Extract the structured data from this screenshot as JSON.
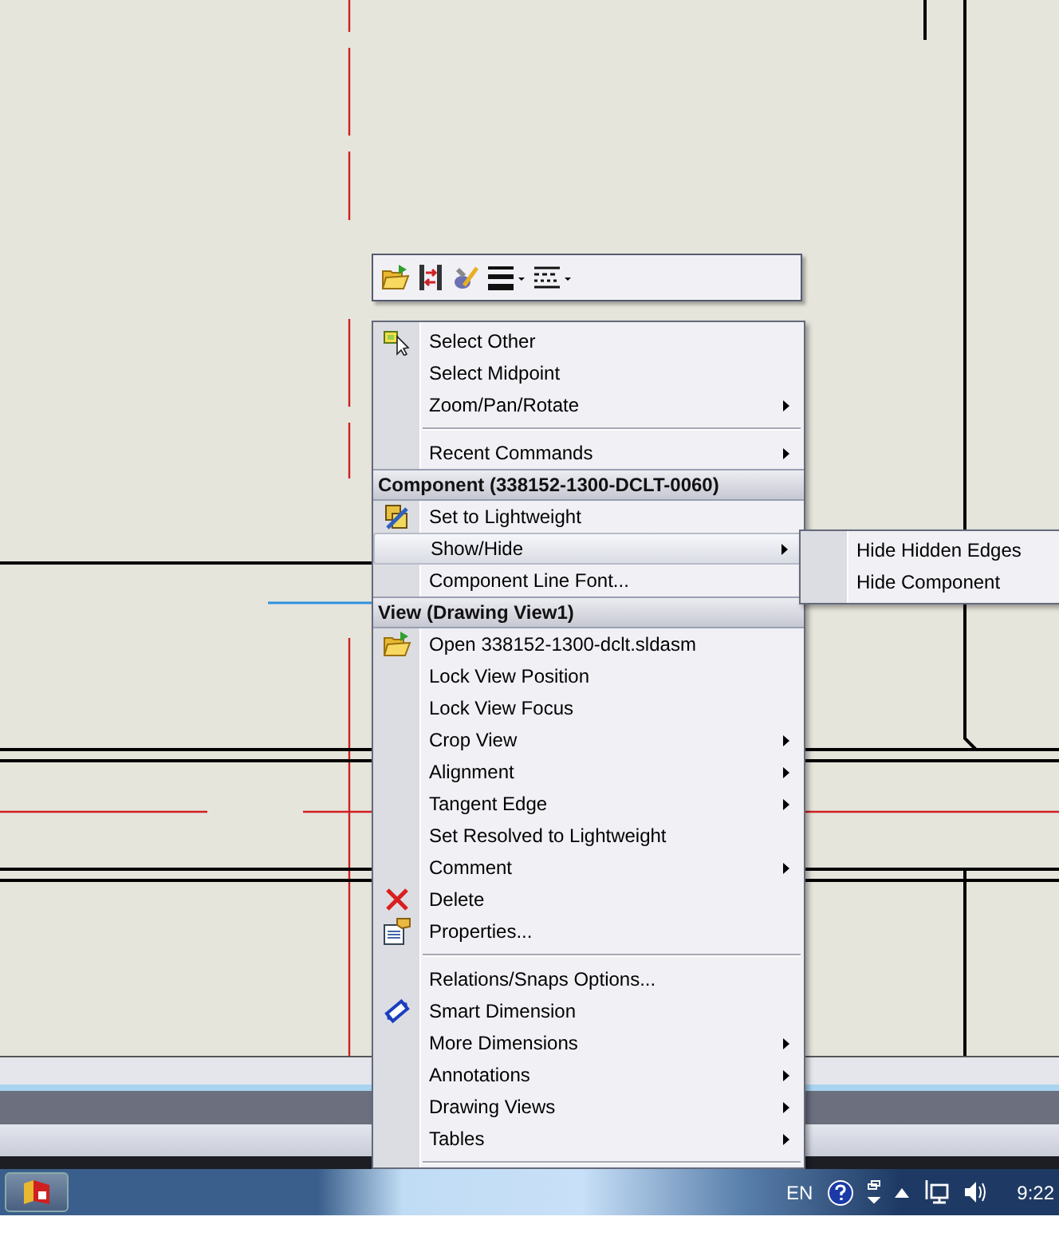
{
  "context_menu": {
    "items": [
      {
        "kind": "item",
        "label": "Select Other",
        "submenu": false,
        "selected": false
      },
      {
        "kind": "item",
        "label": "Select Midpoint",
        "submenu": false,
        "selected": false
      },
      {
        "kind": "item",
        "label": "Zoom/Pan/Rotate",
        "submenu": true,
        "selected": false
      },
      {
        "kind": "separator"
      },
      {
        "kind": "item",
        "label": "Recent Commands",
        "submenu": true,
        "selected": false
      },
      {
        "kind": "header",
        "label": "Component (338152-1300-DCLT-0060)"
      },
      {
        "kind": "item",
        "label": "Set to Lightweight",
        "submenu": false,
        "selected": false
      },
      {
        "kind": "item",
        "label": "Show/Hide",
        "submenu": true,
        "selected": true
      },
      {
        "kind": "item",
        "label": "Component Line Font...",
        "submenu": false,
        "selected": false
      },
      {
        "kind": "header",
        "label": "View (Drawing View1)"
      },
      {
        "kind": "item",
        "label": "Open 338152-1300-dclt.sldasm",
        "submenu": false,
        "selected": false
      },
      {
        "kind": "item",
        "label": "Lock View Position",
        "submenu": false,
        "selected": false
      },
      {
        "kind": "item",
        "label": "Lock View Focus",
        "submenu": false,
        "selected": false
      },
      {
        "kind": "item",
        "label": "Crop View",
        "submenu": true,
        "selected": false
      },
      {
        "kind": "item",
        "label": "Alignment",
        "submenu": true,
        "selected": false
      },
      {
        "kind": "item",
        "label": "Tangent Edge",
        "submenu": true,
        "selected": false
      },
      {
        "kind": "item",
        "label": "Set Resolved to Lightweight",
        "submenu": false,
        "selected": false
      },
      {
        "kind": "item",
        "label": "Comment",
        "submenu": true,
        "selected": false
      },
      {
        "kind": "item",
        "label": "Delete",
        "submenu": false,
        "selected": false
      },
      {
        "kind": "item",
        "label": "Properties...",
        "submenu": false,
        "selected": false
      },
      {
        "kind": "separator"
      },
      {
        "kind": "item",
        "label": "Relations/Snaps Options...",
        "submenu": false,
        "selected": false
      },
      {
        "kind": "item",
        "label": "Smart Dimension",
        "submenu": false,
        "selected": false
      },
      {
        "kind": "item",
        "label": "More Dimensions",
        "submenu": true,
        "selected": false
      },
      {
        "kind": "item",
        "label": "Annotations",
        "submenu": true,
        "selected": false
      },
      {
        "kind": "item",
        "label": "Drawing Views",
        "submenu": true,
        "selected": false
      },
      {
        "kind": "item",
        "label": "Tables",
        "submenu": true,
        "selected": false
      },
      {
        "kind": "separator"
      }
    ]
  },
  "submenu": {
    "items": [
      {
        "label": "Hide Hidden Edges",
        "selected": false
      },
      {
        "label": "Hide Component",
        "selected": false
      }
    ]
  },
  "taskbar": {
    "language": "EN",
    "clock": "9:22"
  }
}
